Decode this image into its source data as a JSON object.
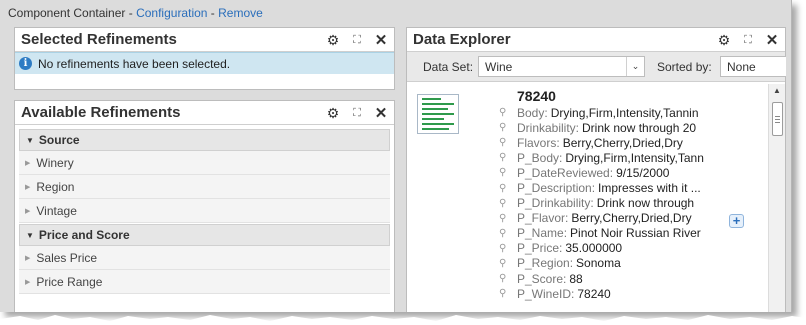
{
  "breadcrumb": {
    "prefix": "Component Container - ",
    "config_link": "Configuration",
    "separator": " - ",
    "remove_link": "Remove"
  },
  "selected_refinements": {
    "title": "Selected Refinements",
    "message": "No refinements have been selected."
  },
  "available_refinements": {
    "title": "Available Refinements",
    "groups": [
      {
        "label": "Source",
        "items": [
          "Winery",
          "Region",
          "Vintage"
        ]
      },
      {
        "label": "Price and Score",
        "items": [
          "Sales Price",
          "Price Range"
        ]
      }
    ]
  },
  "data_explorer": {
    "title": "Data Explorer",
    "dataset_label": "Data Set:",
    "dataset_value": "Wine",
    "sorted_label": "Sorted by:",
    "sorted_value": "None",
    "record": {
      "id": "78240",
      "attributes": [
        {
          "key": "Body:",
          "value": "Drying,Firm,Intensity,Tannin"
        },
        {
          "key": "Drinkability:",
          "value": "Drink now through 20"
        },
        {
          "key": "Flavors:",
          "value": "Berry,Cherry,Dried,Dry"
        },
        {
          "key": "P_Body:",
          "value": "Drying,Firm,Intensity,Tann"
        },
        {
          "key": "P_DateReviewed:",
          "value": "9/15/2000"
        },
        {
          "key": "P_Description:",
          "value": "Impresses with it ..."
        },
        {
          "key": "P_Drinkability:",
          "value": "Drink now through"
        },
        {
          "key": "P_Flavor:",
          "value": "Berry,Cherry,Dried,Dry"
        },
        {
          "key": "P_Name:",
          "value": "Pinot Noir Russian River"
        },
        {
          "key": "P_Price:",
          "value": "35.000000"
        },
        {
          "key": "P_Region:",
          "value": "Sonoma"
        },
        {
          "key": "P_Score:",
          "value": "88"
        },
        {
          "key": "P_WineID:",
          "value": "78240"
        }
      ]
    }
  },
  "icons": {
    "settings": "gear-icon",
    "maximize": "expand-icon",
    "close": "close-icon",
    "info": "info-icon",
    "pin": "pin-icon"
  },
  "colors": {
    "link": "#2a6ebb",
    "info_bar": "#cfe6f1",
    "thumb_lines": "#2f9a4c"
  }
}
